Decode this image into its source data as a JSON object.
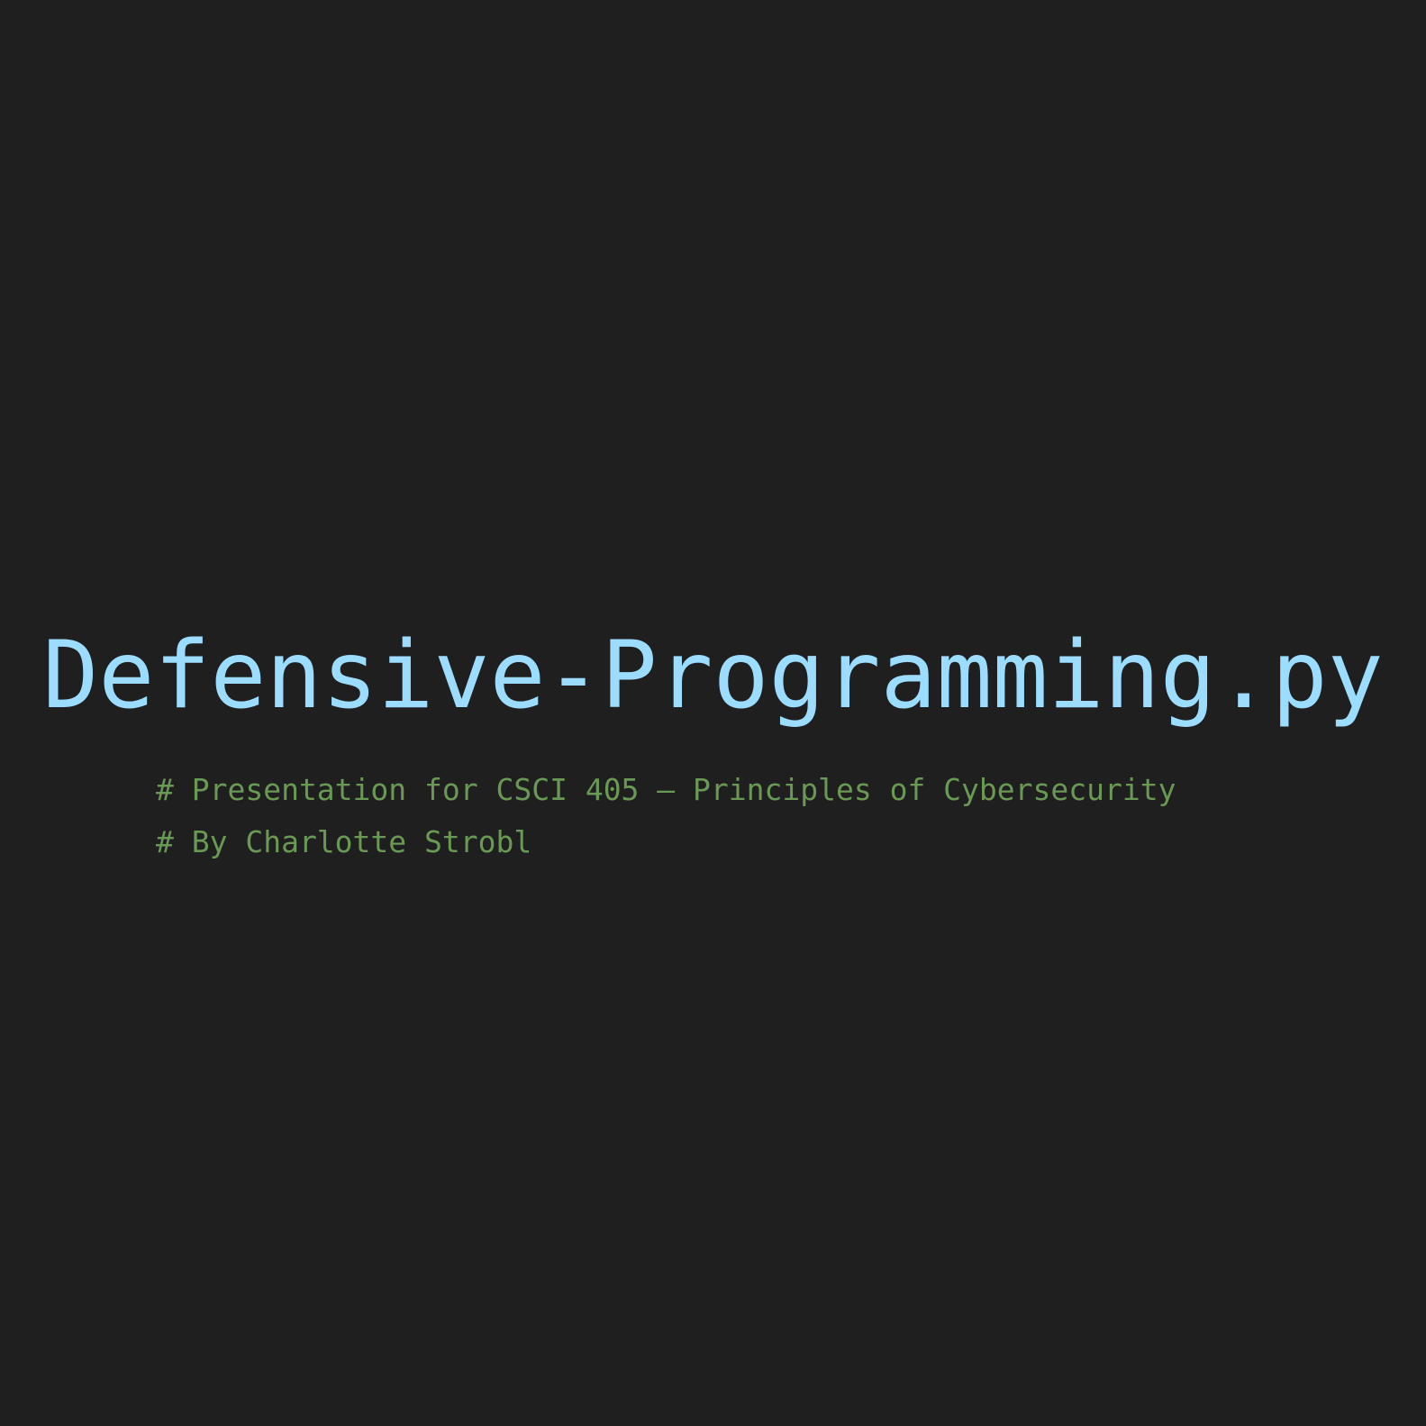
{
  "slide": {
    "title": "Defensive-Programming.py",
    "comments": [
      "# Presentation for CSCI 405 – Principles of Cybersecurity",
      "# By Charlotte Strobl"
    ]
  },
  "colors": {
    "background": "#1f1f1f",
    "title": "#9cdcfe",
    "comment": "#6a9955"
  }
}
